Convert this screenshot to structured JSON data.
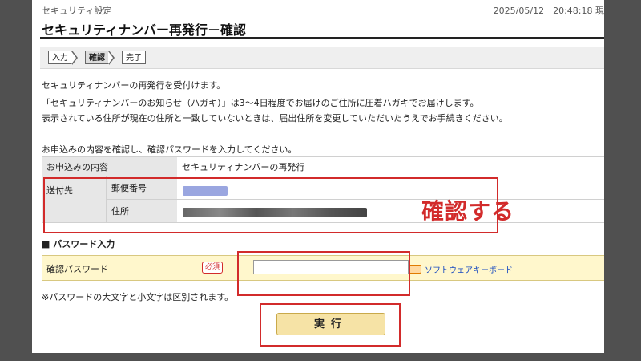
{
  "header": {
    "breadcrumb": "セキュリティ設定",
    "datetime": "2025/05/12　20:48:18 現",
    "title": "セキュリティナンバー再発行－確認"
  },
  "steps": [
    "入力",
    "確認",
    "完了"
  ],
  "intro": {
    "line1": "セキュリティナンバーの再発行を受付けます。",
    "line2": "「セキュリティナンバーのお知らせ（ハガキ）」は3～4日程度でお届けのご住所に圧着ハガキでお届けします。",
    "line3": "表示されている住所が現在の住所と一致していないときは、届出住所を変更していただいたうえでお手続きください。",
    "instruction": "お申込みの内容を確認し、確認パスワードを入力してください。"
  },
  "confirm_table": {
    "application_label": "お申込みの内容",
    "application_value": "セキュリティナンバーの再発行",
    "destination_label": "送付先",
    "postal_code_label": "郵便番号",
    "address_label": "住所"
  },
  "annotation": "確認する",
  "password_section": {
    "heading": "■ パスワード入力",
    "field_label": "確認パスワード",
    "required_badge": "必須",
    "input_value": "",
    "keyboard_link": "ソフトウェアキーボード"
  },
  "note": "※パスワードの大文字と小文字は区別されます。",
  "execute_button": "実行",
  "colors": {
    "annotation_red": "#d22b2b",
    "link_blue": "#1a4cc0",
    "password_row_bg": "#fff7cc",
    "button_bg": "#f6e3a6"
  }
}
